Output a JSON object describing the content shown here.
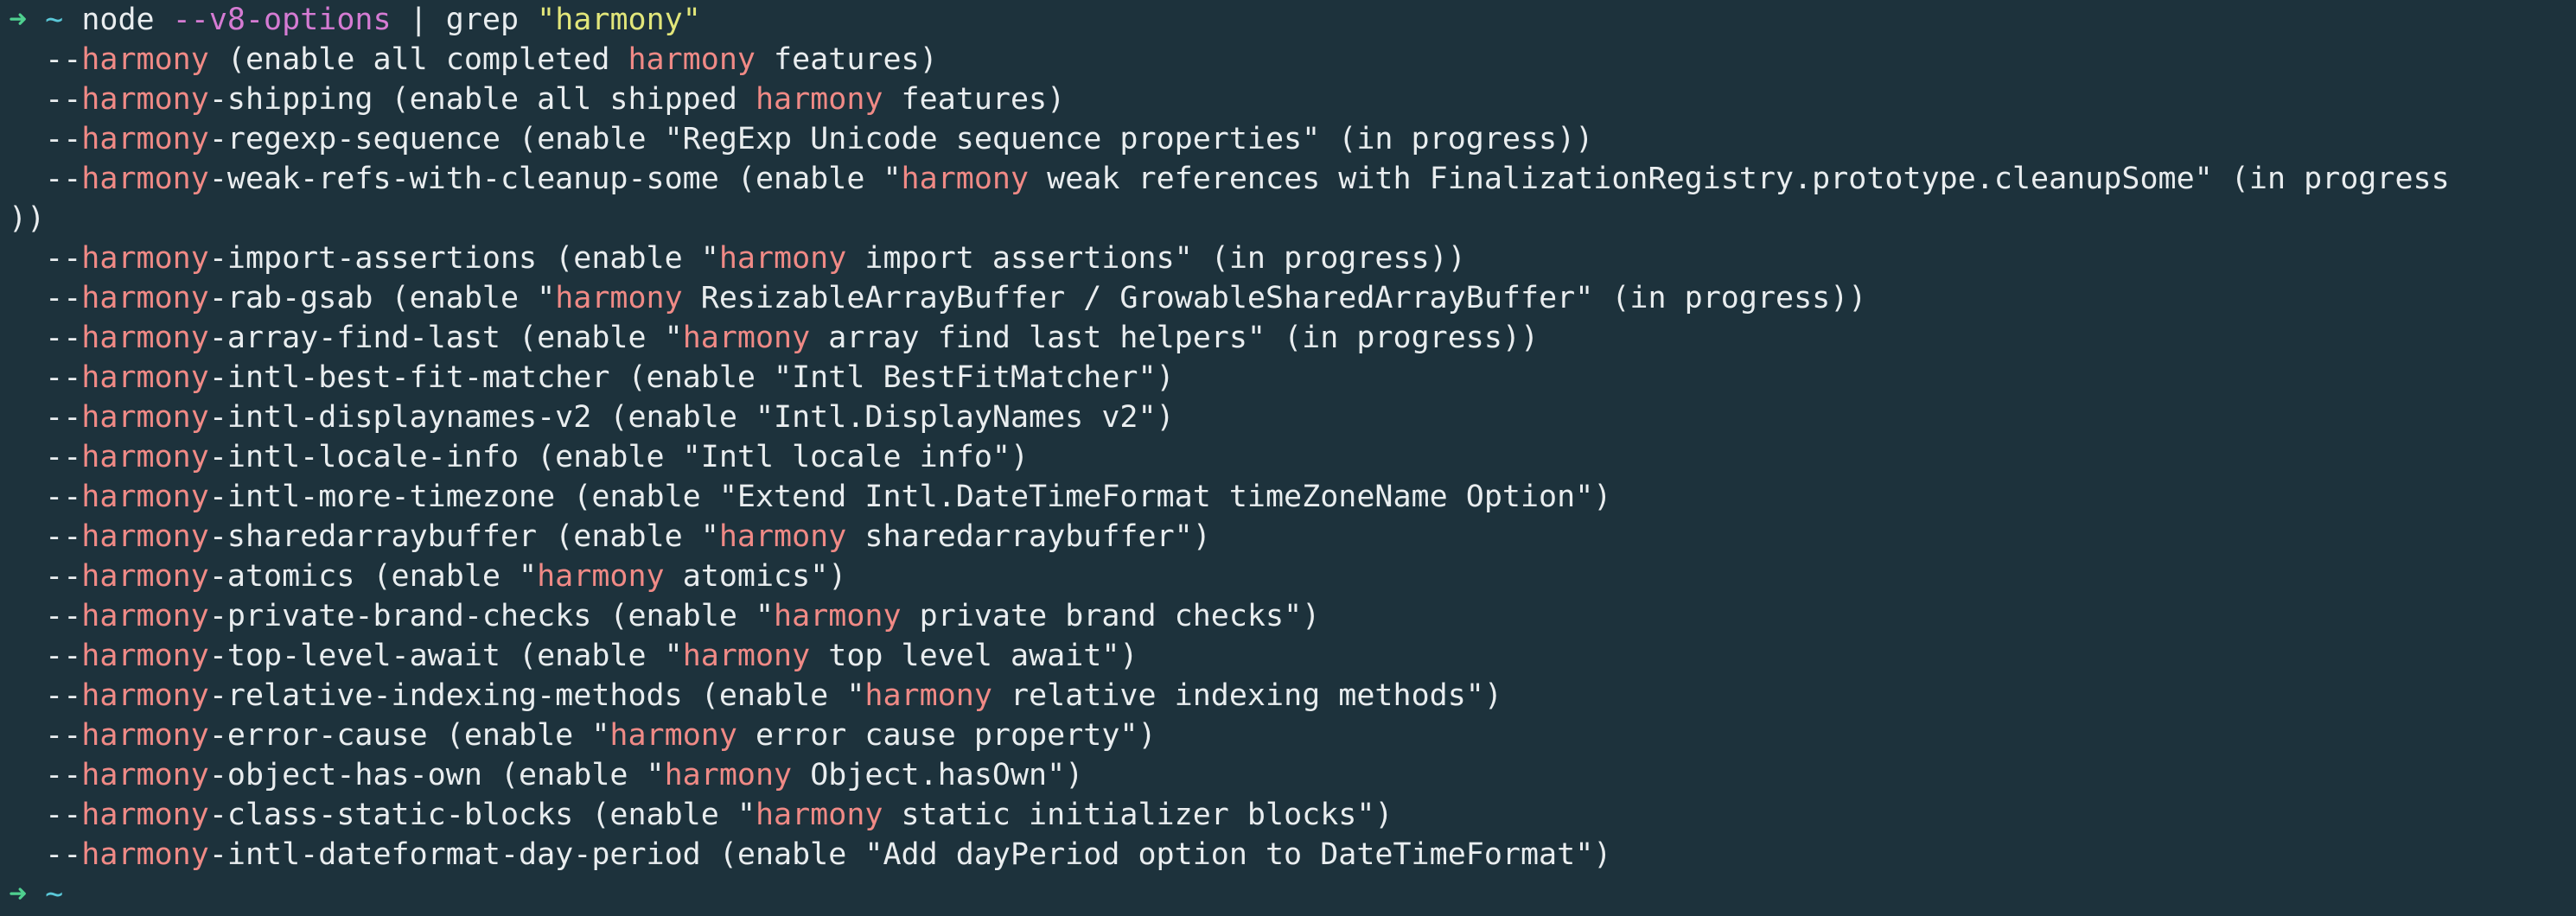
{
  "prompt": {
    "arrow": "➜",
    "cwd": "~",
    "command": "node",
    "option": "--v8-options",
    "pipe": "| grep",
    "pattern": "\"harmony\""
  },
  "highlight": "harmony",
  "output_lines": [
    "  --harmony (enable all completed harmony features)",
    "  --harmony-shipping (enable all shipped harmony features)",
    "  --harmony-regexp-sequence (enable \"RegExp Unicode sequence properties\" (in progress))",
    "  --harmony-weak-refs-with-cleanup-some (enable \"harmony weak references with FinalizationRegistry.prototype.cleanupSome\" (in progress",
    "))",
    "  --harmony-import-assertions (enable \"harmony import assertions\" (in progress))",
    "  --harmony-rab-gsab (enable \"harmony ResizableArrayBuffer / GrowableSharedArrayBuffer\" (in progress))",
    "  --harmony-array-find-last (enable \"harmony array find last helpers\" (in progress))",
    "  --harmony-intl-best-fit-matcher (enable \"Intl BestFitMatcher\")",
    "  --harmony-intl-displaynames-v2 (enable \"Intl.DisplayNames v2\")",
    "  --harmony-intl-locale-info (enable \"Intl locale info\")",
    "  --harmony-intl-more-timezone (enable \"Extend Intl.DateTimeFormat timeZoneName Option\")",
    "  --harmony-sharedarraybuffer (enable \"harmony sharedarraybuffer\")",
    "  --harmony-atomics (enable \"harmony atomics\")",
    "  --harmony-private-brand-checks (enable \"harmony private brand checks\")",
    "  --harmony-top-level-await (enable \"harmony top level await\")",
    "  --harmony-relative-indexing-methods (enable \"harmony relative indexing methods\")",
    "  --harmony-error-cause (enable \"harmony error cause property\")",
    "  --harmony-object-has-own (enable \"harmony Object.hasOwn\")",
    "  --harmony-class-static-blocks (enable \"harmony static initializer blocks\")",
    "  --harmony-intl-dateformat-day-period (enable \"Add dayPeriod option to DateTimeFormat\")"
  ],
  "final_prompt": {
    "arrow": "➜",
    "cwd": "~"
  },
  "colors": {
    "background": "#1d323c",
    "text": "#e9edef",
    "arrow": "#4fd08f",
    "cwd": "#5ac8d8",
    "option": "#d57bd3",
    "string": "#e2e67a",
    "highlight": "#f08a86"
  }
}
